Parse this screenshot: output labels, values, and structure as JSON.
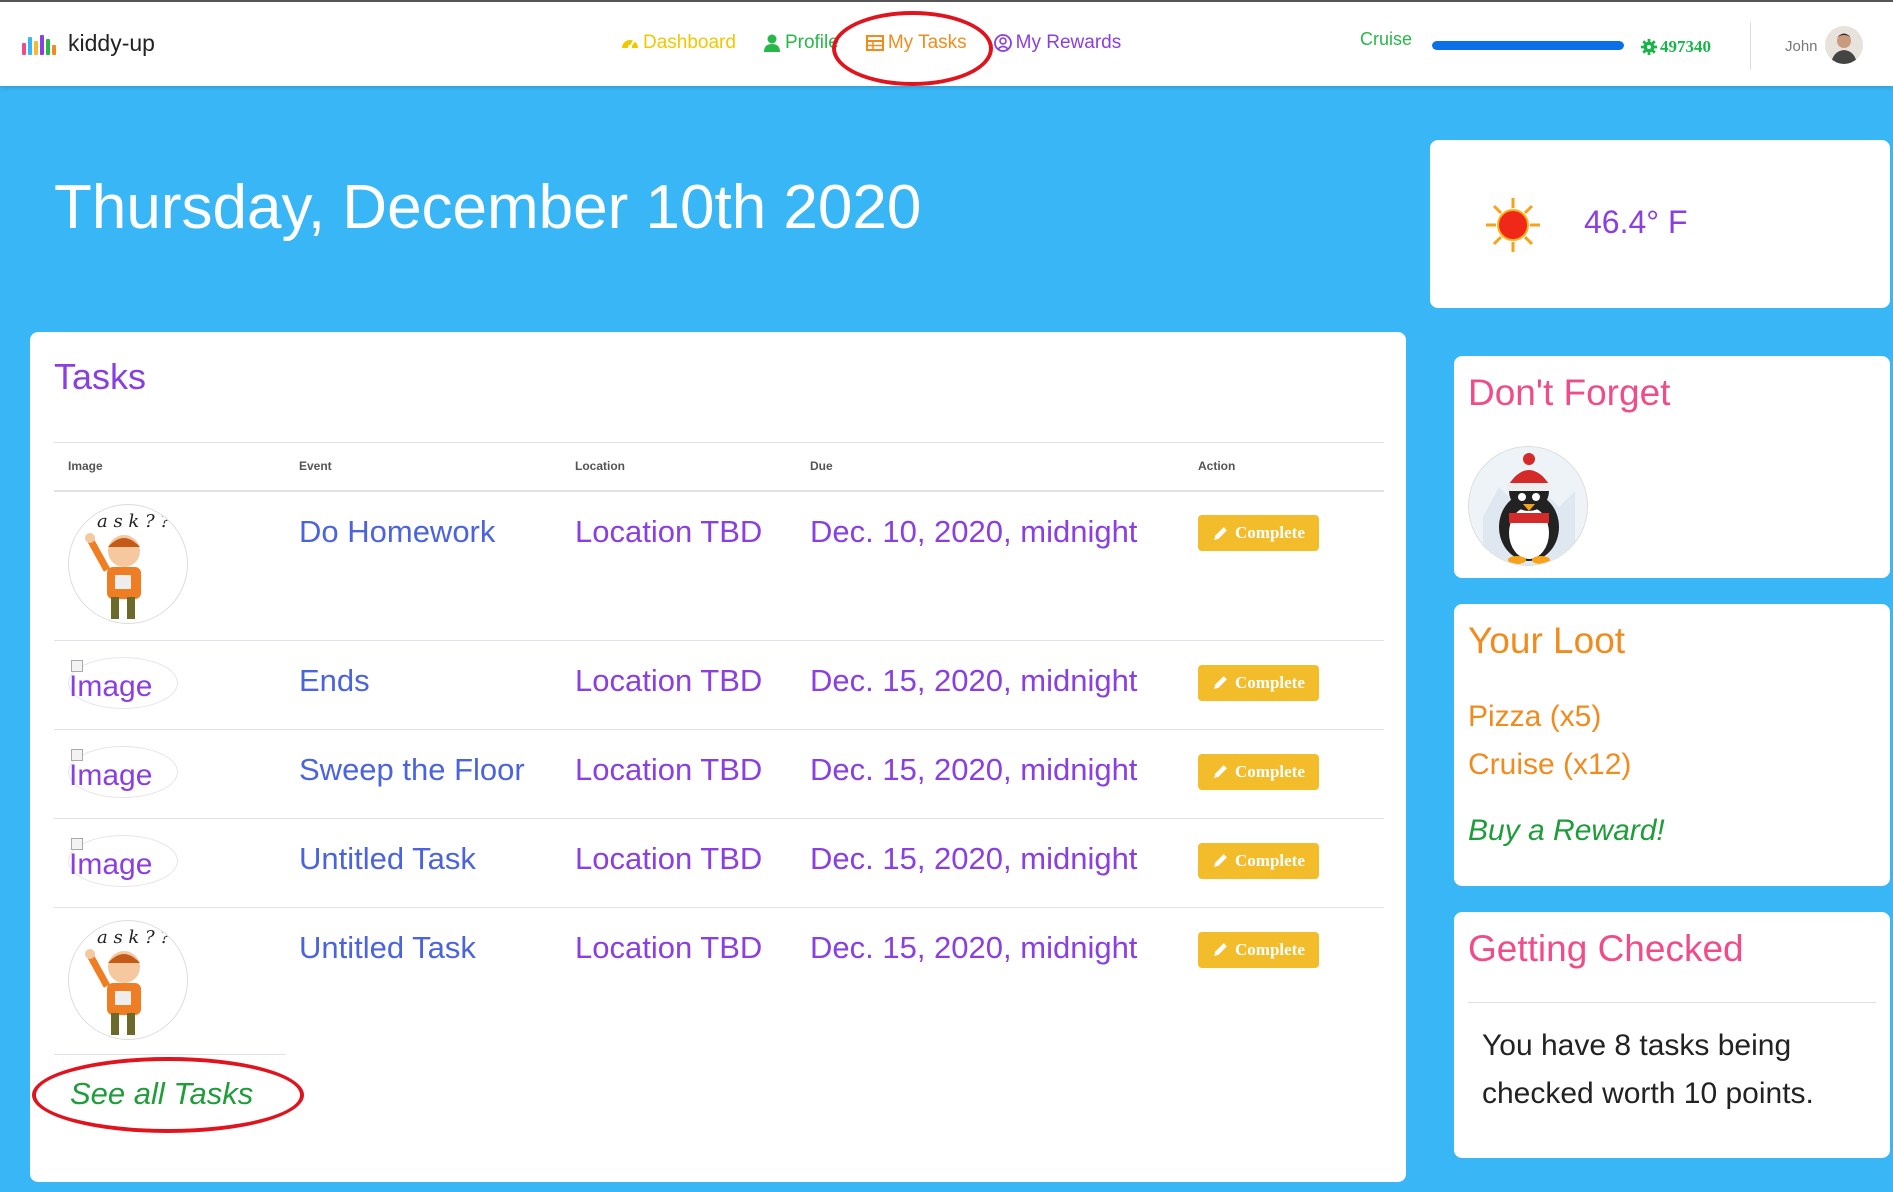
{
  "navbar": {
    "brand": "kiddy-up",
    "links": [
      {
        "label": "Dashboard",
        "icon": "tachometer-icon",
        "color": "#f0c800"
      },
      {
        "label": "Profile",
        "icon": "user-icon",
        "color": "#28b84a"
      },
      {
        "label": "My Tasks",
        "icon": "table-icon",
        "color": "#f08c1e"
      },
      {
        "label": "My Rewards",
        "icon": "user-circle-icon",
        "color": "#8a3fe0"
      }
    ],
    "reward_goal": "Cruise",
    "progress_fraction": 1.0,
    "points": "497340",
    "user_name": "John"
  },
  "date_title": "Thursday, December 10th 2020",
  "tasks": {
    "title": "Tasks",
    "columns": [
      "Image",
      "Event",
      "Location",
      "Due",
      "Action"
    ],
    "rows": [
      {
        "image": "ask-boy",
        "event": "Do Homework",
        "location": "Location TBD",
        "due": "Dec. 10, 2020, midnight",
        "action": "Complete"
      },
      {
        "image": "broken",
        "image_alt": "Image",
        "event": "Ends",
        "location": "Location TBD",
        "due": "Dec. 15, 2020, midnight",
        "action": "Complete"
      },
      {
        "image": "broken",
        "image_alt": "Image",
        "event": "Sweep the Floor",
        "location": "Location TBD",
        "due": "Dec. 15, 2020, midnight",
        "action": "Complete"
      },
      {
        "image": "broken",
        "image_alt": "Image",
        "event": "Untitled Task",
        "location": "Location TBD",
        "due": "Dec. 15, 2020, midnight",
        "action": "Complete"
      },
      {
        "image": "ask-boy",
        "event": "Untitled Task",
        "location": "Location TBD",
        "due": "Dec. 15, 2020, midnight",
        "action": "Complete"
      }
    ],
    "see_all": "See all Tasks"
  },
  "weather": {
    "icon": "sun-icon",
    "temperature": "46.4° F"
  },
  "dont_forget": {
    "title": "Don't Forget",
    "image": "penguin-avatar"
  },
  "loot": {
    "title": "Your Loot",
    "items": [
      "Pizza (x5)",
      "Cruise (x12)"
    ],
    "buy_label": "Buy a Reward!"
  },
  "getting_checked": {
    "title": "Getting Checked",
    "text": "You have 8 tasks being checked worth 10 points."
  },
  "colors": {
    "page_bg": "#38b6f5",
    "purple": "#8a3fe0",
    "orange": "#f08c1e",
    "pink": "#f04c8a",
    "green": "#1f9d3a",
    "button": "#f3bc2b",
    "annotation_red": "#e0141e"
  }
}
